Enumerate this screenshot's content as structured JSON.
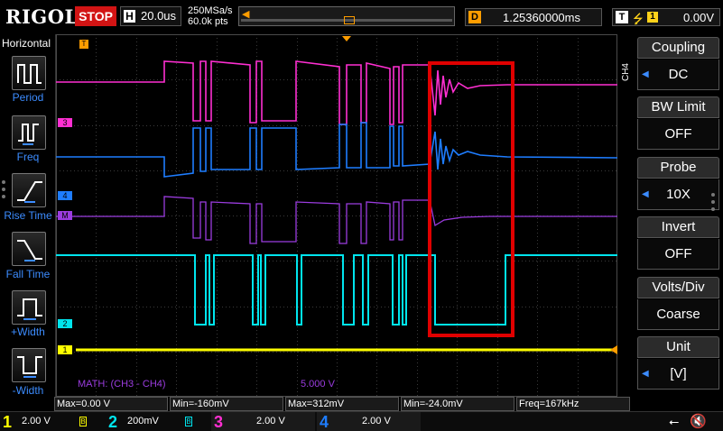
{
  "topbar": {
    "brand": "RIGOL",
    "run_state": "STOP",
    "horizontal_label": "H",
    "timebase": "20.0us",
    "sample_rate": "250MSa/s",
    "memory_depth": "60.0k pts",
    "delay_label": "D",
    "delay_value": "1.25360000ms",
    "trigger_label": "T",
    "trigger_edge_icon": "rising-edge-icon",
    "trigger_source": "1",
    "trigger_level": "0.00V"
  },
  "left_panel": {
    "title": "Horizontal",
    "items": [
      {
        "label": "Period",
        "icon": "period-measure-icon"
      },
      {
        "label": "Freq",
        "icon": "frequency-measure-icon"
      },
      {
        "label": "Rise Time",
        "icon": "rise-time-icon"
      },
      {
        "label": "Fall Time",
        "icon": "fall-time-icon"
      },
      {
        "label": "+Width",
        "icon": "positive-width-icon"
      },
      {
        "label": "-Width",
        "icon": "negative-width-icon"
      }
    ]
  },
  "right_panel": {
    "channel_tag": "CH4",
    "items": [
      {
        "title": "Coupling",
        "value": "DC"
      },
      {
        "title": "BW Limit",
        "value": "OFF"
      },
      {
        "title": "Probe",
        "value": "10X"
      },
      {
        "title": "Invert",
        "value": "OFF"
      },
      {
        "title": "Volts/Div",
        "value": "Coarse"
      },
      {
        "title": "Unit",
        "value": "[V]"
      }
    ]
  },
  "waveform": {
    "marker_trigger_pos": "T",
    "ch3_marker": "3",
    "ch4_marker": "4",
    "math_marker": "M",
    "ch2_marker": "2",
    "ch1_marker": "1",
    "math_label": "MATH: (CH3 - CH4)",
    "math_scale": "5.000 V",
    "colors": {
      "ch1": "#ffff00",
      "ch2": "#00e5ee",
      "ch3": "#ff2fd2",
      "ch4": "#1e7dff",
      "math": "#9b3cdf",
      "highlight_box": "#e00000",
      "trigger_marker": "#ff9d00"
    }
  },
  "measurements": [
    {
      "text": "Max=0.00 V"
    },
    {
      "text": "Min=-160mV"
    },
    {
      "text": "Max=312mV"
    },
    {
      "text": "Min=-24.0mV"
    },
    {
      "text": "Freq=167kHz"
    }
  ],
  "bottom_channels": [
    {
      "number": "1",
      "scale": "2.00 V",
      "color": "#ffff00"
    },
    {
      "number": "2",
      "scale": "200mV",
      "color": "#00e5ee"
    },
    {
      "number": "3",
      "scale": "2.00 V",
      "color": "#ff2fd2"
    },
    {
      "number": "4",
      "scale": "2.00 V",
      "color": "#1e7dff"
    }
  ],
  "status_icons": [
    "usb-icon",
    "speaker-muted-icon"
  ]
}
